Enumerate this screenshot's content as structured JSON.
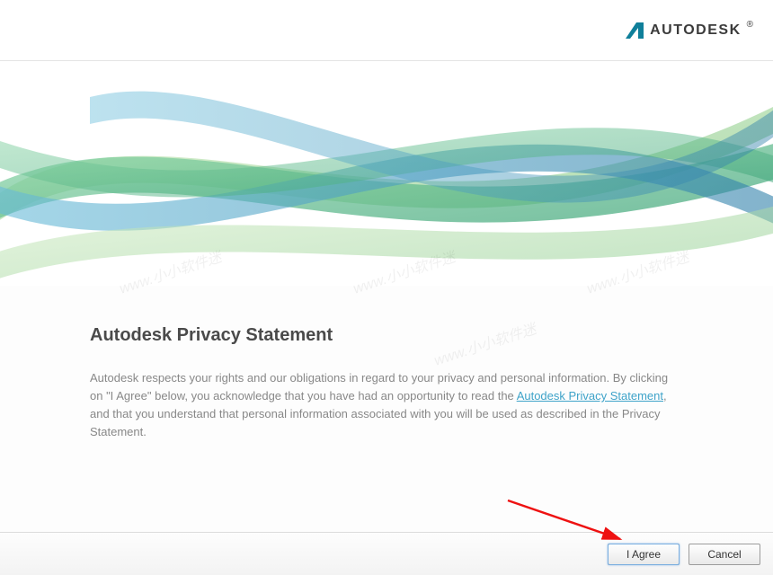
{
  "brand": {
    "name": "AUTODESK",
    "accent": "#0f7f9a"
  },
  "page": {
    "title": "Autodesk Privacy Statement",
    "body_pre": "Autodesk respects your rights and our obligations in regard to your privacy and personal information. By clicking on \"I Agree\" below, you acknowledge that you have had an opportunity to read the ",
    "link_text": "Autodesk Privacy Statement",
    "body_post": ", and that you understand that  personal information associated with you will be used as described in the Privacy Statement."
  },
  "buttons": {
    "agree": "I Agree",
    "cancel": "Cancel"
  },
  "watermark": "www.小小软件迷"
}
